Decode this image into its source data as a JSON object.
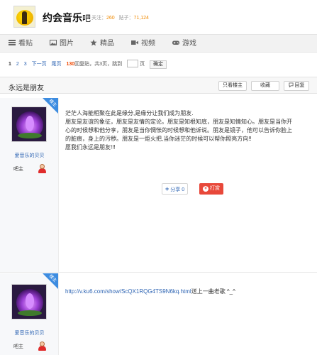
{
  "forum": {
    "title": "约会音乐",
    "suffix": "吧",
    "stats_follow_label": "关注：",
    "stats_follow": "260",
    "stats_posts_label": "贴子：",
    "stats_posts": "71,124"
  },
  "nav": [
    {
      "label": "看贴",
      "icon": "list-icon"
    },
    {
      "label": "图片",
      "icon": "image-icon"
    },
    {
      "label": "精品",
      "icon": "star-icon"
    },
    {
      "label": "视频",
      "icon": "video-icon"
    },
    {
      "label": "游戏",
      "icon": "gamepad-icon"
    }
  ],
  "pager": {
    "current": "1",
    "page2": "2",
    "page3": "3",
    "next": "下一页",
    "last": "尾页",
    "reply_count": "130",
    "reply_suffix": "回复贴，共3页，跳到",
    "page_unit": "页",
    "confirm": "确定"
  },
  "thread": {
    "title": "永远是朋友",
    "only_author": "只看楼主",
    "favorite": "收藏",
    "reply": "回复"
  },
  "posts": [
    {
      "badge": "楼主",
      "username": "爱音乐的贝贝",
      "role": "吧主",
      "lines": [
        "茫茫人海能相聚在此是缘分,是缘分让我们成为朋友.",
        "朋友是友谊的象征，朋友是友情的定论。朋友是知根知底，朋友是知情知心。朋友是当你开",
        "心的时候想和他分享，朋友是当你惆怅的时候想和他诉说。朋友是镜子，他可以告诉你脸上",
        "的脏痕，身上的污秽。朋友是一炬火把,当你迷茫的时候可以帮你照亮方向!!",
        "愿我们永远是朋友!!!"
      ],
      "share_label": "分享 0",
      "tip_label": "打赏"
    },
    {
      "badge": "楼主",
      "username": "爱音乐的贝贝",
      "role": "吧主",
      "link": "http://v.ku6.com/show/ScQX1RQG4TS9N6kq.html",
      "link_suffix": "送上一曲老歌 ^_^"
    }
  ]
}
